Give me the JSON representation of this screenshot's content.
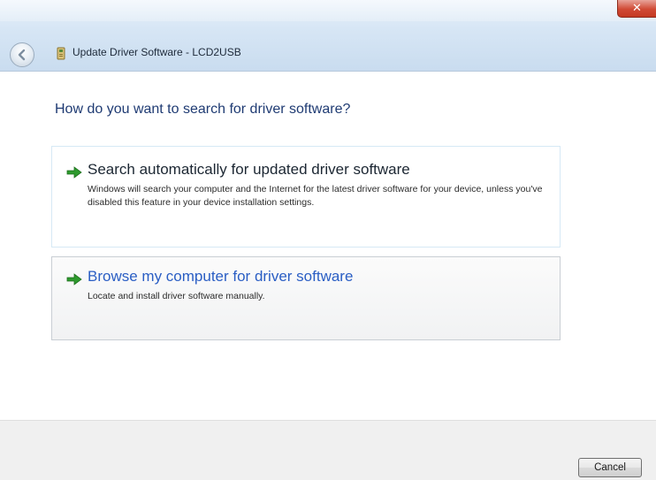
{
  "window": {
    "title": "Update Driver Software - LCD2USB",
    "close_glyph": "✕",
    "icons": {
      "back": "back-arrow-icon",
      "device": "device-driver-icon",
      "close": "close-icon"
    }
  },
  "main": {
    "heading": "How do you want to search for driver software?",
    "options": [
      {
        "title": "Search automatically for updated driver software",
        "description": "Windows will search your computer and the Internet for the latest driver software for your device, unless you've disabled this feature in your device installation settings.",
        "icon": "green-arrow-icon"
      },
      {
        "title": "Browse my computer for driver software",
        "description": "Locate and install driver software manually.",
        "icon": "green-arrow-icon"
      }
    ]
  },
  "footer": {
    "cancel_label": "Cancel"
  },
  "colors": {
    "heading": "#1f3b73",
    "link_blue": "#2a5ec4",
    "arrow_green": "#2e9a2e",
    "close_red": "#d04a34"
  }
}
